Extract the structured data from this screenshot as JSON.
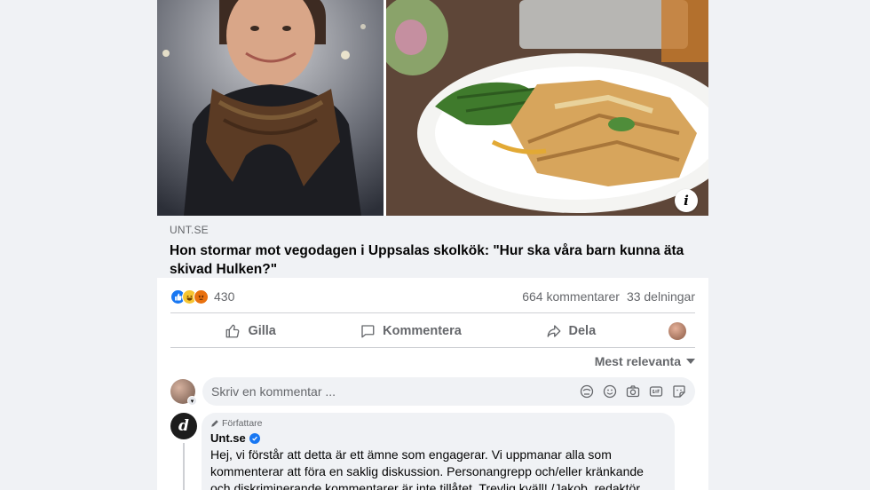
{
  "link_preview": {
    "domain": "UNT.SE",
    "title": "Hon stormar mot vegodagen i Uppsalas skolkök: \"Hur ska våra barn kunna äta skivad Hulken?\""
  },
  "hero": {
    "info_glyph": "i"
  },
  "reactions": {
    "count": "430",
    "comments": "664 kommentarer",
    "shares": "33 delningar"
  },
  "actions": {
    "like": "Gilla",
    "comment": "Kommentera",
    "share": "Dela"
  },
  "sort": {
    "label": "Mest relevanta"
  },
  "composer": {
    "placeholder": "Skriv en kommentar ..."
  },
  "author_comment": {
    "avatar_glyph": "d",
    "badge": "Författare",
    "name": "Unt.se",
    "text": "Hej, vi förstår att detta är ett ämne som engagerar. Vi uppmanar alla som kommenterar att föra en saklig diskussion. Personangrepp och/eller kränkande och diskriminerande kommentarer är inte tillåtet. Trevlig kväll! /Jakob, redaktör"
  },
  "colors": {
    "accent": "#1877f2",
    "secondary_text": "#65676b",
    "background": "#f0f2f5"
  }
}
